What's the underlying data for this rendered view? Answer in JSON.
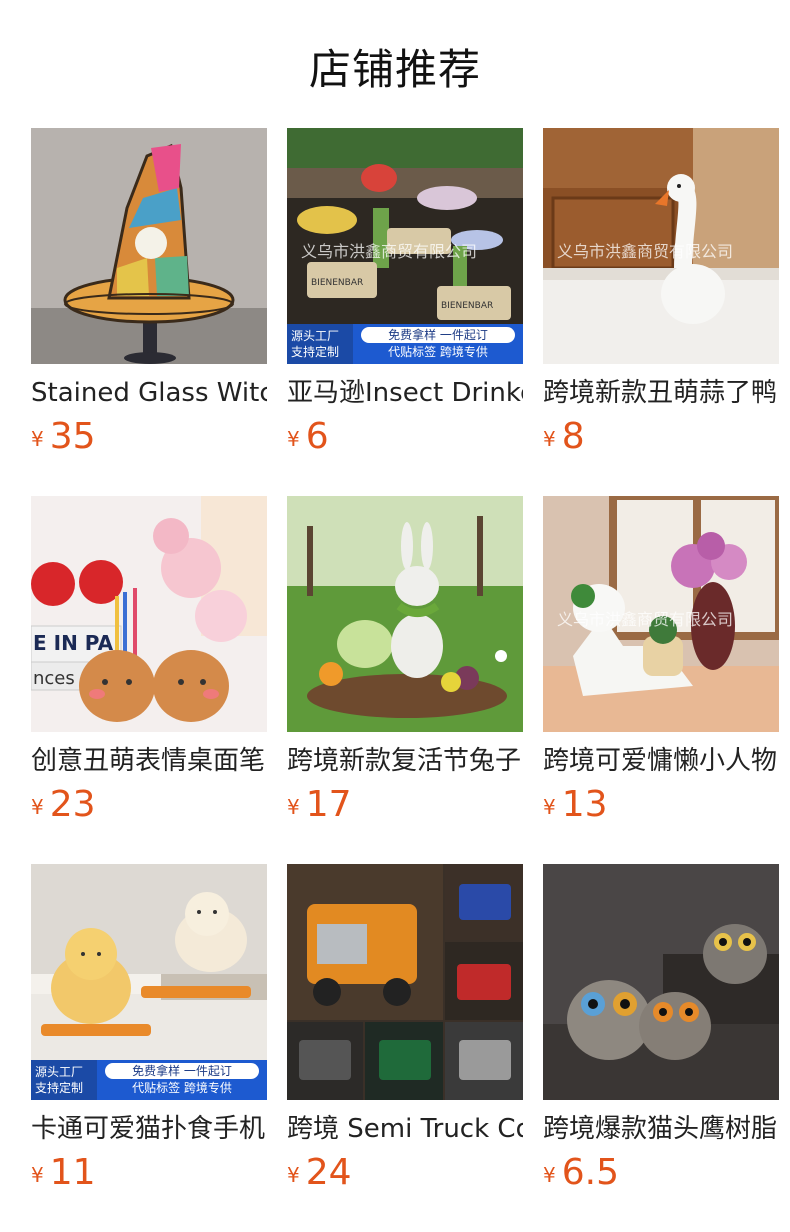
{
  "header": {
    "title": "店铺推荐"
  },
  "currency_symbol": "¥",
  "colors": {
    "price": "#e2541b",
    "title_text": "#222222",
    "promo_blue": "#1d5ad0"
  },
  "products": [
    {
      "title": "Stained Glass Witch",
      "price": "35",
      "image": "witch-hat-image"
    },
    {
      "title": "亚马逊Insect Drinke",
      "price": "6",
      "image": "garden-insect-image",
      "watermark": "义乌市洪鑫商贸有限公司",
      "promo": {
        "left_line1": "源头工厂",
        "left_line2": "支持定制",
        "pill": "免费拿样 一件起订",
        "sub": "代贴标签 跨境专供"
      },
      "sign_text": "BIENENBAR"
    },
    {
      "title": "跨境新款丑萌蒜了鸭",
      "price": "8",
      "image": "duck-garlic-image",
      "watermark": "义乌市洪鑫商贸有限公司"
    },
    {
      "title": "创意丑萌表情桌面笔",
      "price": "23",
      "image": "pen-holder-image",
      "photo_text": "E IN PA",
      "photo_text2": "nces"
    },
    {
      "title": "跨境新款复活节兔子",
      "price": "17",
      "image": "easter-rabbit-image"
    },
    {
      "title": "跨境可爱慵懒小人物",
      "price": "13",
      "image": "lazy-figure-image",
      "watermark": "义乌市洪鑫商贸有限公司"
    },
    {
      "title": "卡通可爱猫扑食手机",
      "price": "11",
      "image": "cat-phone-stand-image",
      "promo": {
        "left_line1": "源头工厂",
        "left_line2": "支持定制",
        "pill": "免费拿样 一件起订",
        "sub": "代贴标签 跨境专供"
      }
    },
    {
      "title": "跨境 Semi Truck Co",
      "price": "24",
      "image": "truck-mug-image"
    },
    {
      "title": "跨境爆款猫头鹰树脂",
      "price": "6.5",
      "image": "owl-image"
    }
  ]
}
